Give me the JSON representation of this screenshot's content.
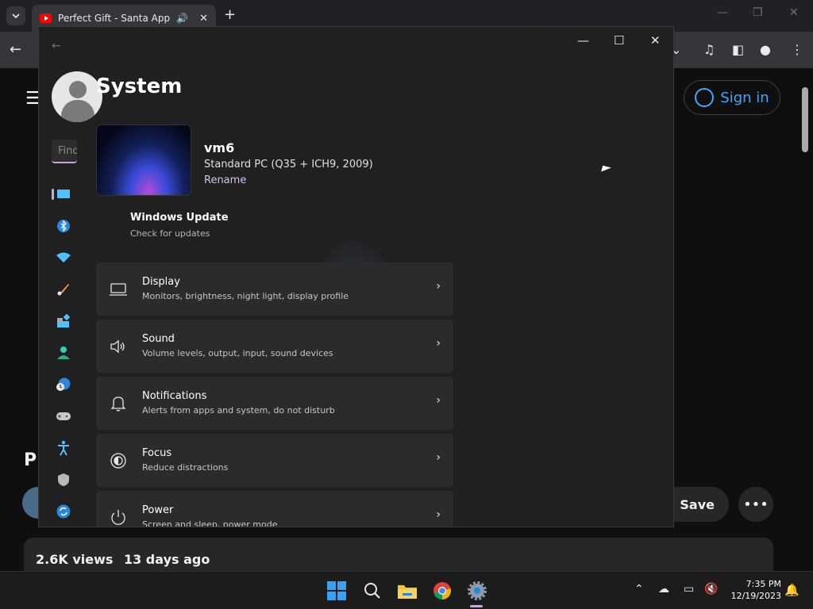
{
  "browser": {
    "tab_title": "Perfect Gift - Santa Approved",
    "new_tab_glyph": "+",
    "icons": [
      "chevron-down-icon",
      "audio-icon",
      "close-icon",
      "back-icon",
      "media-icon",
      "sidebar-icon",
      "profile-icon",
      "kebab-icon"
    ]
  },
  "youtube": {
    "sign_in": "Sign in",
    "title_fragment": "P",
    "save_label": "Save",
    "views": "2.6K views",
    "date": "13 days ago"
  },
  "settings": {
    "search_placeholder": "Find",
    "page_title": "System",
    "device": {
      "name": "vm6",
      "model": "Standard PC (Q35 + ICH9, 2009)",
      "rename": "Rename"
    },
    "windows_update": {
      "title": "Windows Update",
      "subtitle": "Check for updates"
    },
    "nav_icons": [
      "system-icon",
      "bluetooth-icon",
      "network-icon",
      "personalization-icon",
      "apps-icon",
      "accounts-icon",
      "time-language-icon",
      "gaming-icon",
      "accessibility-icon",
      "privacy-icon",
      "update-icon"
    ],
    "cards": [
      {
        "title": "Display",
        "subtitle": "Monitors, brightness, night light, display profile",
        "icon": "display-icon"
      },
      {
        "title": "Sound",
        "subtitle": "Volume levels, output, input, sound devices",
        "icon": "speaker-icon"
      },
      {
        "title": "Notifications",
        "subtitle": "Alerts from apps and system, do not disturb",
        "icon": "bell-icon"
      },
      {
        "title": "Focus",
        "subtitle": "Reduce distractions",
        "icon": "focus-icon"
      },
      {
        "title": "Power",
        "subtitle": "Screen and sleep, power mode",
        "icon": "power-icon"
      }
    ]
  },
  "taskbar": {
    "time": "7:35 PM",
    "date": "12/19/2023",
    "accent": "#c9a6e6"
  }
}
